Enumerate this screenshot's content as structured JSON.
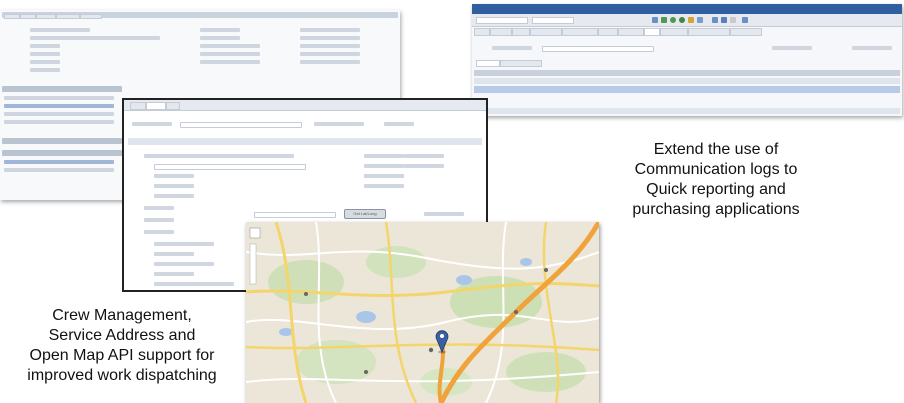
{
  "captions": {
    "right_lines": [
      "Extend the use of",
      "Communication logs to",
      "Quick reporting and",
      "purchasing applications"
    ],
    "left_lines": [
      "Crew Management,",
      "Service Address and",
      "Open Map API support for",
      "improved work dispatching"
    ]
  },
  "screenshots": {
    "top_right": {
      "title_bar_color": "#2f5f9e",
      "active_tab": "Tasks",
      "row_status": "Open"
    },
    "center": {
      "button": "Get Lat/Long",
      "tabs": [
        "Main",
        "Address",
        "Map"
      ]
    }
  }
}
